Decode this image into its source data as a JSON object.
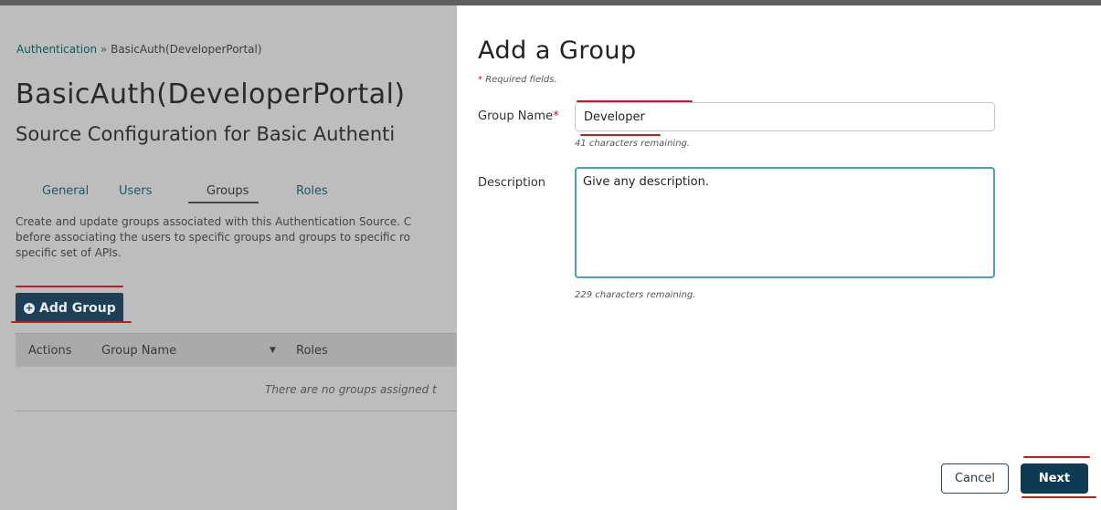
{
  "background": {
    "breadcrumb": {
      "root": "Authentication",
      "separator": "»",
      "current": "BasicAuth(DeveloperPortal)"
    },
    "title": "BasicAuth(DeveloperPortal)",
    "subtitle": "Source Configuration for Basic Authenti",
    "tabs": [
      {
        "label": "General"
      },
      {
        "label": "Users"
      },
      {
        "label": "Groups",
        "active": true
      },
      {
        "label": "Roles"
      }
    ],
    "description_lines": [
      "Create and update groups associated with this Authentication Source. C",
      "before associating the users to specific groups and groups to specific ro",
      "specific set of APIs."
    ],
    "add_group_button": "Add Group",
    "grid_headers": {
      "actions": "Actions",
      "group_name": "Group Name",
      "sort_indicator": "▼",
      "roles": "Roles"
    },
    "empty_message": "There are no groups assigned t"
  },
  "modal": {
    "title": "Add a Group",
    "required_note": {
      "star": "*",
      "text": "Required fields."
    },
    "group_name": {
      "label": "Group Name",
      "required_star": "*",
      "value": "Developer",
      "hint": "41 characters remaining."
    },
    "description": {
      "label": "Description",
      "value": "Give any description.",
      "hint": "229 characters remaining."
    },
    "cancel_label": "Cancel",
    "next_label": "Next"
  },
  "colors": {
    "annotation_red": "#d0161e",
    "primary_dark": "#0f3b52",
    "focus_teal": "#4ea3a3",
    "overlay_gray": "#bdbdbd"
  }
}
